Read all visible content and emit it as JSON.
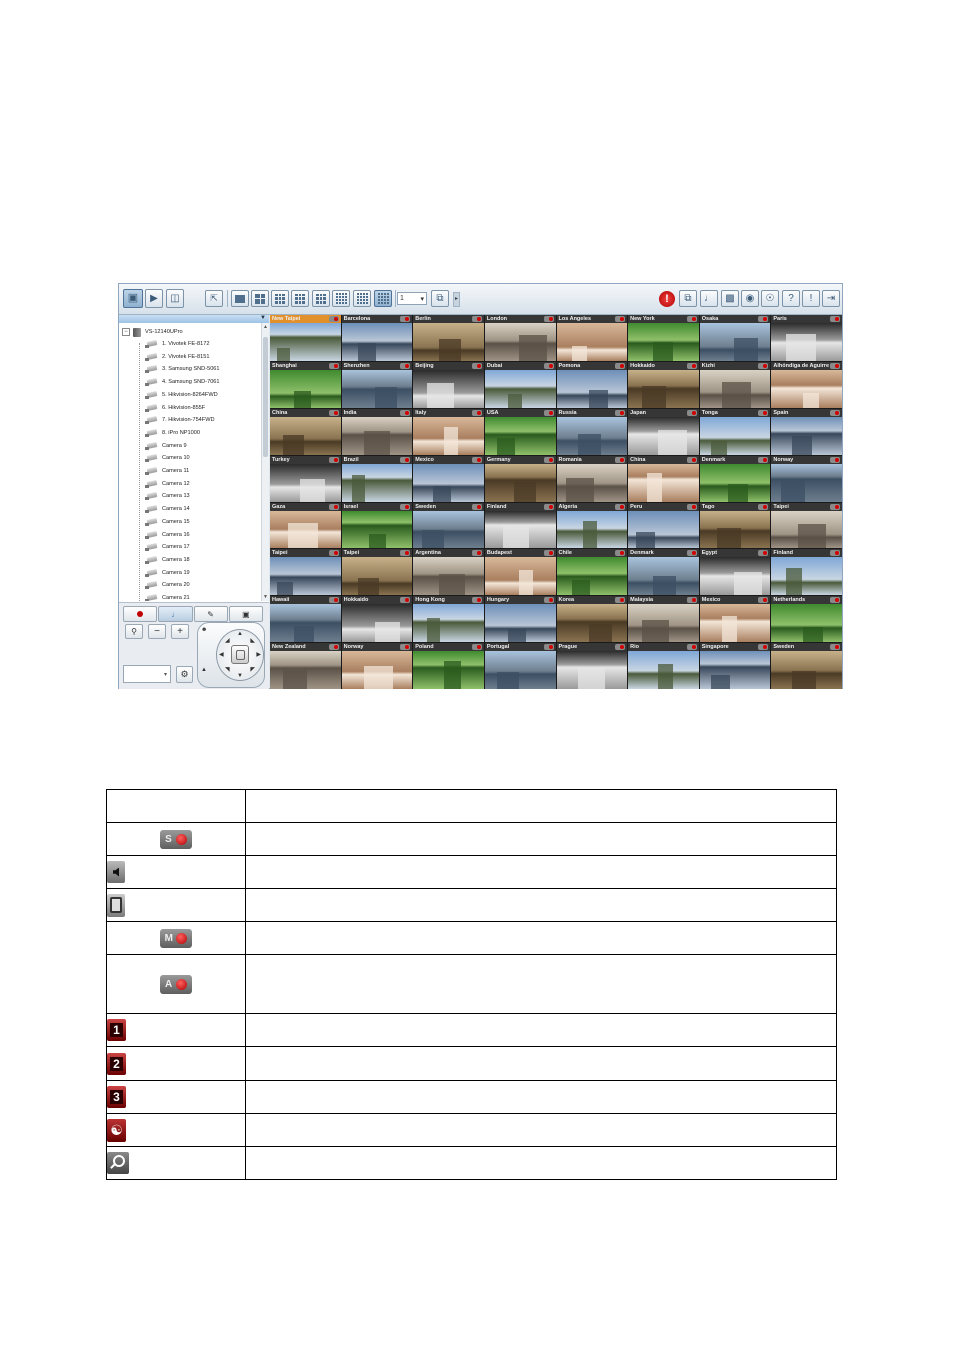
{
  "toolbar": {
    "page_value": "1",
    "buttons": [
      "monitor",
      "playback",
      "config",
      "fullscreen",
      "layout-1",
      "layout-4",
      "layout-6",
      "layout-8",
      "layout-9",
      "layout-10",
      "layout-16",
      "layout-custom",
      "sequence",
      "alert",
      "ptz",
      "audio",
      "snapshot",
      "record",
      "web",
      "help",
      "about",
      "logout"
    ]
  },
  "tree": {
    "root": "VS-12140UPro",
    "cameras": [
      "1. Vivotek FE-8172",
      "2. Vivotek FE-8151",
      "3. Samsung SND-5061",
      "4. Samsung SND-7061",
      "5. Hikvision-8264FWD",
      "6. Hikvision-855F",
      "7. Hikvision-754FWD",
      "8. iPro NP1000",
      "Camera 9",
      "Camera 10",
      "Camera 11",
      "Camera 12",
      "Camera 13",
      "Camera 14",
      "Camera 15",
      "Camera 16",
      "Camera 17",
      "Camera 18",
      "Camera 19",
      "Camera 20",
      "Camera 21"
    ]
  },
  "cameras": [
    "New Taipei",
    "Barcelona",
    "Berlin",
    "London",
    "Los Angeles",
    "New York",
    "Osaka",
    "Paris",
    "Shanghai",
    "Shenzhen",
    "Beijing",
    "Dubai",
    "Pomona",
    "Hokkaido",
    "Kizhi",
    "Alhóndiga de Aguirre",
    "China",
    "India",
    "Italy",
    "USA",
    "Russia",
    "Japan",
    "Tonga",
    "Spain",
    "Turkey",
    "Brazil",
    "Mexico",
    "Germany",
    "Romania",
    "China",
    "Denmark",
    "Norway",
    "Gaza",
    "Israel",
    "Sweden",
    "Finland",
    "Algeria",
    "Peru",
    "Tago",
    "Taipei",
    "Taipei",
    "Taipei",
    "Argentina",
    "Budapest",
    "Chile",
    "Denmark",
    "Egypt",
    "Finland",
    "Hawaii",
    "Hokkaido",
    "Hong Kong",
    "Hungary",
    "Korea",
    "Malaysia",
    "Mexico",
    "Netherlands",
    "New Zealand",
    "Norway",
    "Poland",
    "Portugal",
    "Prague",
    "Rio",
    "Singapore",
    "Sweden"
  ],
  "legend": [
    {
      "icon": "schedule-record-icon",
      "letter": "S",
      "description": ""
    },
    {
      "icon": "speaker-icon",
      "description": ""
    },
    {
      "icon": "microphone-icon",
      "description": ""
    },
    {
      "icon": "manual-record-icon",
      "letter": "M",
      "description": ""
    },
    {
      "icon": "alarm-record-icon",
      "letter": "A",
      "description": ""
    },
    {
      "icon": "alarm-input-1-icon",
      "number": "1",
      "description": ""
    },
    {
      "icon": "alarm-input-2-icon",
      "number": "2",
      "description": ""
    },
    {
      "icon": "alarm-input-3-icon",
      "number": "3",
      "description": ""
    },
    {
      "icon": "motion-detection-icon",
      "description": ""
    },
    {
      "icon": "digital-zoom-icon",
      "description": ""
    }
  ],
  "colors": {
    "selected_tile": "#e2902b",
    "record_dot": "#d00000",
    "toolbar_bg": "#dfe7ef"
  }
}
